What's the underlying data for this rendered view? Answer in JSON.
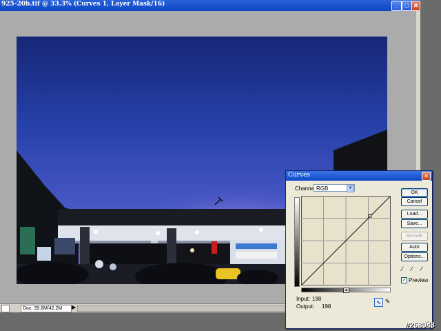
{
  "window": {
    "title": "925-20b.tif @ 33.3% (Curves 1, Layer Mask/16)",
    "minimize_glyph": "_",
    "maximize_glyph": "□",
    "close_glyph": "✕"
  },
  "statusbar": {
    "doc_info": "Doc: 39.8M/42.2M",
    "arrow_glyph": "▶"
  },
  "curves_dialog": {
    "title": "Curves",
    "close_glyph": "✕",
    "channel_label": "Channel:",
    "channel_value": "RGB",
    "dropdown_glyph": "▼",
    "input_label": "Input:",
    "input_value": "198",
    "output_label": "Output:",
    "output_value": "198",
    "buttons": {
      "ok": "OK",
      "cancel": "Cancel",
      "load": "Load...",
      "save": "Save...",
      "smooth": "Smooth",
      "auto": "Auto",
      "options": "Options..."
    },
    "preview_label": "Preview",
    "preview_checked": true,
    "curve_tool_icon": "curve-tool-icon",
    "pencil_tool_icon": "pencil-tool-icon",
    "eyedroppers": [
      "black-eyedropper-icon",
      "gray-eyedropper-icon",
      "white-eyedropper-icon"
    ]
  },
  "watermark": "#268943",
  "colors": {
    "title_blue": "#0b46c4",
    "dialog_bg": "#ece9d8",
    "graph_bg": "#e8e2cc",
    "sky_top": "#1a2b7a",
    "sky_horizon": "#c7a0d8"
  }
}
